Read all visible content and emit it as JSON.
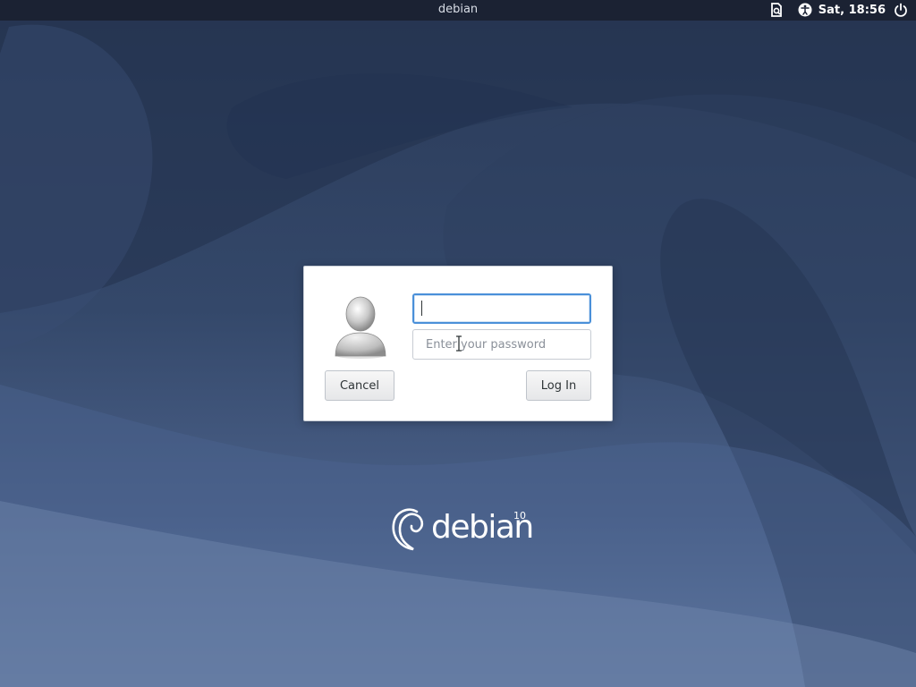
{
  "topbar": {
    "title": "debian",
    "clock": "Sat, 18:56",
    "icons": [
      "notes-icon",
      "accessibility-icon",
      "power-icon"
    ]
  },
  "login": {
    "username_value": "",
    "password_placeholder": "Enter your password",
    "cancel_label": "Cancel",
    "login_label": "Log In",
    "focus_color": "#4a90d9"
  },
  "branding": {
    "name": "debian",
    "version": "10"
  }
}
